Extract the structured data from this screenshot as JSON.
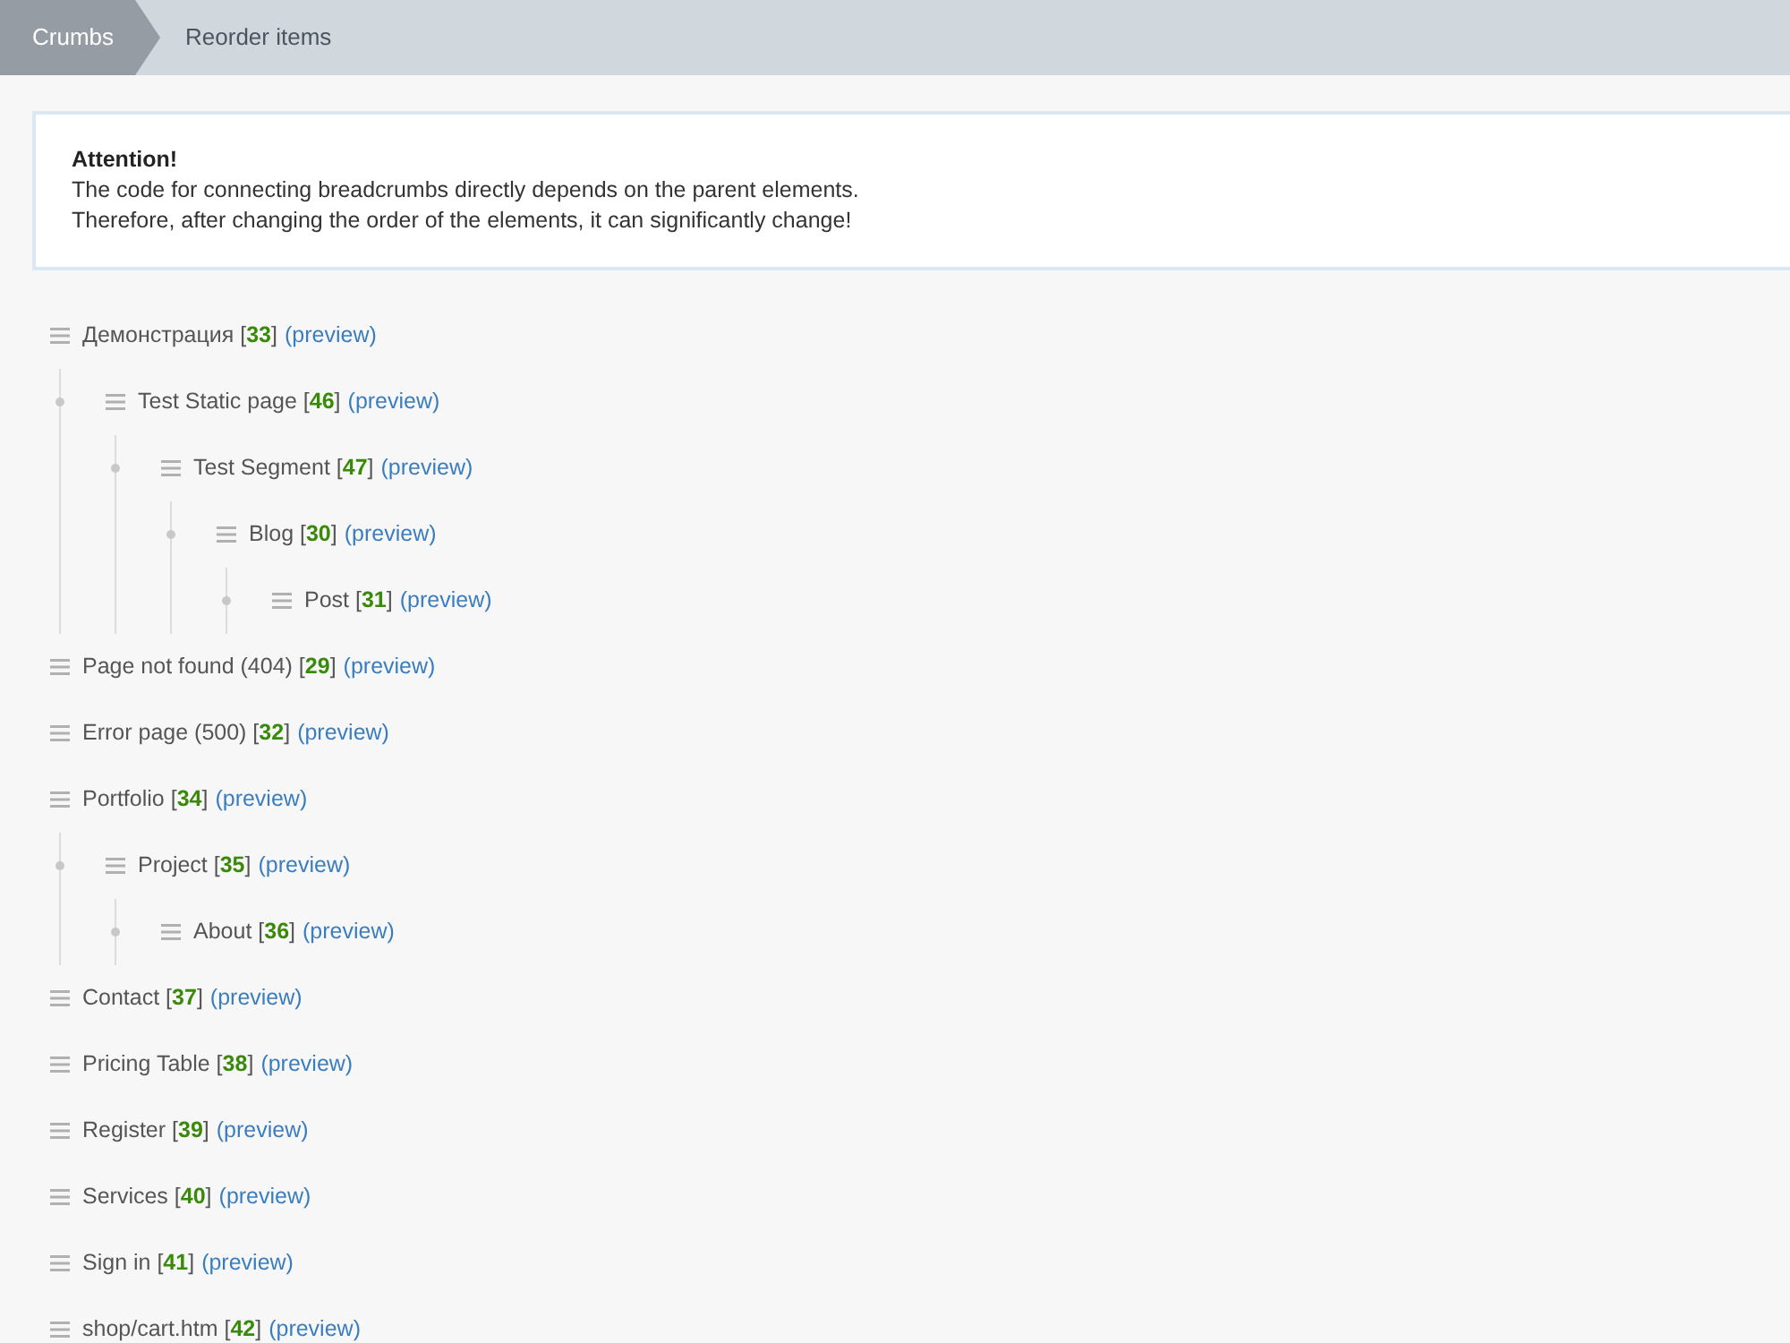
{
  "breadcrumbs": [
    {
      "label": "Crumbs",
      "selected": true
    },
    {
      "label": "Reorder items",
      "selected": false
    }
  ],
  "alert": {
    "title": "Attention!",
    "lines": [
      "The code for connecting breadcrumbs directly depends on the parent elements.",
      "Therefore, after changing the order of the elements, it can significantly change!"
    ]
  },
  "tree": [
    {
      "label": "Демонстрация [**33**]",
      "link": "(preview)",
      "children": [
        {
          "label": "Test Static page [**46**]",
          "link": "(preview)",
          "children": [
            {
              "label": "Test Segment [**47**]",
              "link": "(preview)",
              "children": [
                {
                  "label": "Blog [**30**]",
                  "link": "(preview)",
                  "children": [
                    {
                      "label": "Post [**31**]",
                      "link": "(preview)"
                    }
                  ]
                }
              ]
            }
          ]
        }
      ]
    },
    {
      "label": "Page not found (404) [**29**]",
      "link": "(preview)"
    },
    {
      "label": "Error page (500) [**32**]",
      "link": "(preview)"
    },
    {
      "label": "Portfolio [**34**]",
      "link": "(preview)",
      "children": [
        {
          "label": "Project [**35**]",
          "link": "(preview)",
          "children": [
            {
              "label": "About [**36**]",
              "link": "(preview)"
            }
          ]
        }
      ]
    },
    {
      "label": "Contact [**37**]",
      "link": "(preview)"
    },
    {
      "label": "Pricing Table [**38**]",
      "link": "(preview)"
    },
    {
      "label": "Register [**39**]",
      "link": "(preview)"
    },
    {
      "label": "Services [**40**]",
      "link": "(preview)"
    },
    {
      "label": "Sign in [**41**]",
      "link": "(preview)"
    },
    {
      "label": "shop/cart.htm [**42**]",
      "link": "(preview)"
    }
  ]
}
